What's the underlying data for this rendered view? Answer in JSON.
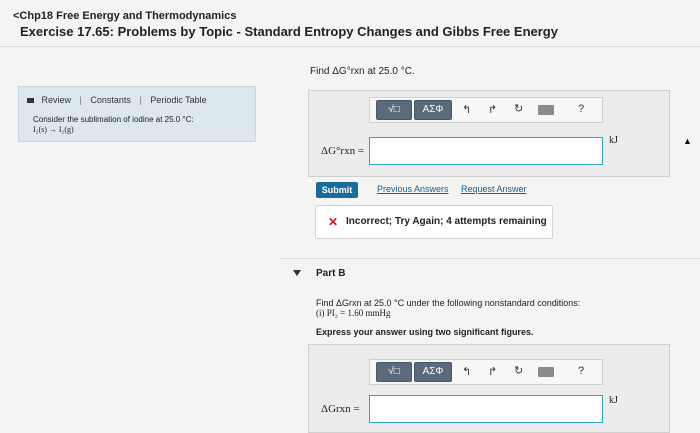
{
  "header": {
    "breadcrumb": "<Chp18 Free Energy and Thermodynamics",
    "exercise_title": "Exercise 17.65: Problems by Topic - Standard Entropy Changes and Gibbs Free Energy"
  },
  "left_panel": {
    "links": [
      "Review",
      "Constants",
      "Periodic Table"
    ],
    "text": "Consider the sublimation of iodine at 25.0 °C:",
    "reaction": "I₂(s) → I₂(g)"
  },
  "part_a": {
    "prompt": "Find ΔG°rxn at 25.0 °C.",
    "toolbar": {
      "frac_label": "√□",
      "greek_label": "ΑΣΦ",
      "undo_icon": "↰",
      "redo_icon": "↱",
      "reset_icon": "↻",
      "keyboard_icon": "⌨",
      "help_label": "?"
    },
    "input_label": "ΔG°rxn =",
    "input_value": "",
    "unit": "kJ",
    "submit_label": "Submit",
    "previous_answers_label": "Previous Answers",
    "request_answer_label": "Request Answer",
    "feedback_text": "Incorrect; Try Again; 4 attempts remaining"
  },
  "part_b": {
    "title": "Part B",
    "line1": "Find ΔGrxn at 25.0 °C under the following nonstandard conditions:",
    "line2": "(i) PI₂ = 1.60 mmHg",
    "instruction": "Express your answer using two significant figures.",
    "toolbar": {
      "frac_label": "√□",
      "greek_label": "ΑΣΦ",
      "undo_icon": "↰",
      "redo_icon": "↱",
      "reset_icon": "↻",
      "keyboard_icon": "⌨",
      "help_label": "?"
    },
    "input_label": "ΔGrxn =",
    "input_value": "",
    "unit": "kJ"
  },
  "colors": {
    "panel_bg": "#dce8ee",
    "submit_bg": "#1b6c9b",
    "error": "#c81e1e",
    "input_border": "#2fa7b8"
  }
}
